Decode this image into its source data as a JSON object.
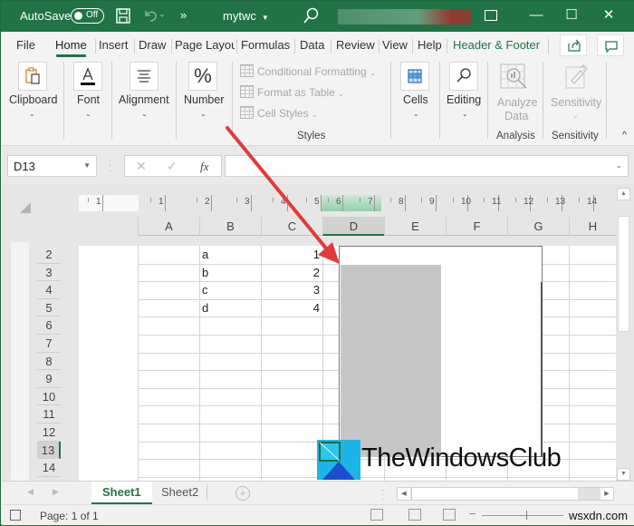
{
  "titlebar": {
    "autosave_label": "AutoSave",
    "autosave_state": "Off",
    "doc_name": "mytwc",
    "icons": [
      "save-icon",
      "undo-icon",
      "more-commands-icon",
      "search-icon",
      "ribbon-display-icon",
      "minimize-icon",
      "maximize-icon",
      "close-icon"
    ],
    "more_glyph": "»",
    "minimize_glyph": "—",
    "maximize_glyph": "☐",
    "close_glyph": "✕"
  },
  "tabs": [
    {
      "label": "File"
    },
    {
      "label": "Home",
      "active": true
    },
    {
      "label": "Insert"
    },
    {
      "label": "Draw"
    },
    {
      "label": "Page Layout"
    },
    {
      "label": "Formulas"
    },
    {
      "label": "Data"
    },
    {
      "label": "Review"
    },
    {
      "label": "View"
    },
    {
      "label": "Help"
    },
    {
      "label": "Header & Footer",
      "contextual": true
    }
  ],
  "ribbon": {
    "clipboard": "Clipboard",
    "font": "Font",
    "alignment": "Alignment",
    "number": "Number",
    "number_glyph": "%",
    "styles": {
      "conditional_formatting": "Conditional Formatting",
      "format_as_table": "Format as Table",
      "cell_styles": "Cell Styles",
      "group_label": "Styles"
    },
    "cells": "Cells",
    "editing": "Editing",
    "analyze_data_1": "Analyze",
    "analyze_data_2": "Data",
    "analysis_group": "Analysis",
    "sensitivity": "Sensitivity",
    "sensitivity_group": "Sensitivity",
    "caret": "⌄",
    "collapse_glyph": "^"
  },
  "formula_bar": {
    "name_box": "D13",
    "cancel_glyph": "✕",
    "enter_glyph": "✓",
    "fx_label": "fx",
    "formula_value": ""
  },
  "sheet": {
    "ruler_numbers": [
      "1",
      "1",
      "2",
      "3",
      "4",
      "5",
      "6",
      "7",
      "8",
      "9",
      "10",
      "11",
      "12",
      "13",
      "14"
    ],
    "columns": [
      "A",
      "B",
      "C",
      "D",
      "E",
      "F",
      "G",
      "H"
    ],
    "selected_column": "D",
    "rows": [
      "2",
      "3",
      "4",
      "5",
      "6",
      "7",
      "8",
      "9",
      "10",
      "11",
      "12",
      "13",
      "14"
    ],
    "selected_row": "13",
    "data": [
      {
        "b": "a",
        "c": "1"
      },
      {
        "b": "b",
        "c": "2"
      },
      {
        "b": "c",
        "c": "3"
      },
      {
        "b": "d",
        "c": "4"
      }
    ]
  },
  "watermark": {
    "logo_text": "TheWindowsClub",
    "site": "wsxdn.com"
  },
  "sheet_tabs": {
    "tabs": [
      "Sheet1",
      "Sheet2"
    ],
    "active": "Sheet1",
    "add_glyph": "+"
  },
  "status": {
    "page": "Page: 1 of 1"
  },
  "colors": {
    "brand": "#217346",
    "arrow": "#e03c3c"
  }
}
